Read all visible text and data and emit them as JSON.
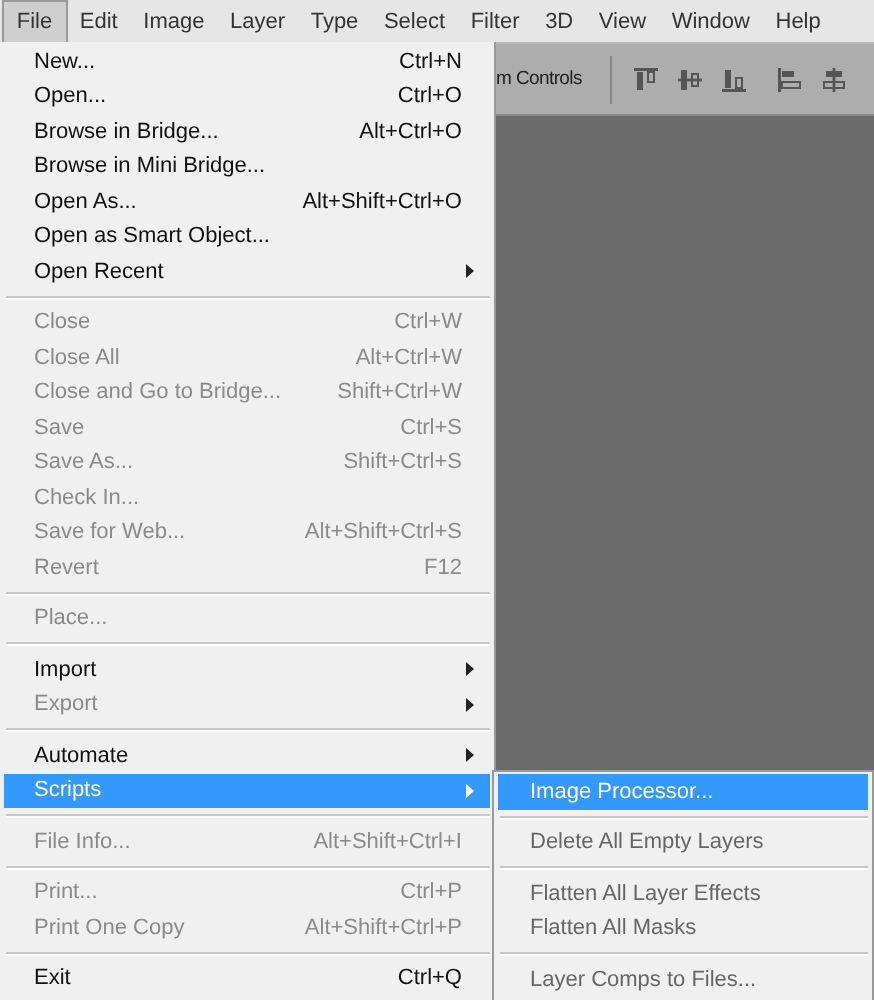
{
  "menu_bar": [
    {
      "label": "File",
      "selected": true
    },
    {
      "label": "Edit",
      "selected": false
    },
    {
      "label": "Image",
      "selected": false
    },
    {
      "label": "Layer",
      "selected": false
    },
    {
      "label": "Type",
      "selected": false
    },
    {
      "label": "Select",
      "selected": false
    },
    {
      "label": "Filter",
      "selected": false
    },
    {
      "label": "3D",
      "selected": false
    },
    {
      "label": "View",
      "selected": false
    },
    {
      "label": "Window",
      "selected": false
    },
    {
      "label": "Help",
      "selected": false
    }
  ],
  "options_bar": {
    "label": "m Controls"
  },
  "file_menu": [
    [
      {
        "label": "New...",
        "shortcut": "Ctrl+N",
        "disabled": false,
        "submenu": false,
        "selected": false
      },
      {
        "label": "Open...",
        "shortcut": "Ctrl+O",
        "disabled": false,
        "submenu": false,
        "selected": false
      },
      {
        "label": "Browse in Bridge...",
        "shortcut": "Alt+Ctrl+O",
        "disabled": false,
        "submenu": false,
        "selected": false
      },
      {
        "label": "Browse in Mini Bridge...",
        "disabled": false,
        "submenu": false,
        "selected": false
      },
      {
        "label": "Open As...",
        "shortcut": "Alt+Shift+Ctrl+O",
        "disabled": false,
        "submenu": false,
        "selected": false
      },
      {
        "label": "Open as Smart Object...",
        "disabled": false,
        "submenu": false,
        "selected": false
      },
      {
        "label": "Open Recent",
        "disabled": false,
        "submenu": true,
        "selected": false
      }
    ],
    [
      {
        "label": "Close",
        "shortcut": "Ctrl+W",
        "disabled": true,
        "submenu": false,
        "selected": false
      },
      {
        "label": "Close All",
        "shortcut": "Alt+Ctrl+W",
        "disabled": true,
        "submenu": false,
        "selected": false
      },
      {
        "label": "Close and Go to Bridge...",
        "shortcut": "Shift+Ctrl+W",
        "disabled": true,
        "submenu": false,
        "selected": false
      },
      {
        "label": "Save",
        "shortcut": "Ctrl+S",
        "disabled": true,
        "submenu": false,
        "selected": false
      },
      {
        "label": "Save As...",
        "shortcut": "Shift+Ctrl+S",
        "disabled": true,
        "submenu": false,
        "selected": false
      },
      {
        "label": "Check In...",
        "disabled": true,
        "submenu": false,
        "selected": false
      },
      {
        "label": "Save for Web...",
        "shortcut": "Alt+Shift+Ctrl+S",
        "disabled": true,
        "submenu": false,
        "selected": false
      },
      {
        "label": "Revert",
        "shortcut": "F12",
        "disabled": true,
        "submenu": false,
        "selected": false
      }
    ],
    [
      {
        "label": "Place...",
        "disabled": true,
        "submenu": false,
        "selected": false
      }
    ],
    [
      {
        "label": "Import",
        "disabled": false,
        "submenu": true,
        "selected": false
      },
      {
        "label": "Export",
        "disabled": true,
        "submenu": true,
        "selected": false
      }
    ],
    [
      {
        "label": "Automate",
        "disabled": false,
        "submenu": true,
        "selected": false
      },
      {
        "label": "Scripts",
        "disabled": false,
        "submenu": true,
        "selected": true
      }
    ],
    [
      {
        "label": "File Info...",
        "shortcut": "Alt+Shift+Ctrl+I",
        "disabled": true,
        "submenu": false,
        "selected": false
      }
    ],
    [
      {
        "label": "Print...",
        "shortcut": "Ctrl+P",
        "disabled": true,
        "submenu": false,
        "selected": false
      },
      {
        "label": "Print One Copy",
        "shortcut": "Alt+Shift+Ctrl+P",
        "disabled": true,
        "submenu": false,
        "selected": false
      }
    ],
    [
      {
        "label": "Exit",
        "shortcut": "Ctrl+Q",
        "disabled": false,
        "submenu": false,
        "selected": false
      }
    ]
  ],
  "scripts_submenu": [
    [
      {
        "label": "Image Processor...",
        "disabled": false,
        "selected": true
      }
    ],
    [
      {
        "label": "Delete All Empty Layers",
        "disabled": true,
        "selected": false
      }
    ],
    [
      {
        "label": "Flatten All Layer Effects",
        "disabled": true,
        "selected": false
      },
      {
        "label": "Flatten All Masks",
        "disabled": true,
        "selected": false
      }
    ],
    [
      {
        "label": "Layer Comps to Files...",
        "disabled": true,
        "selected": false
      }
    ]
  ]
}
